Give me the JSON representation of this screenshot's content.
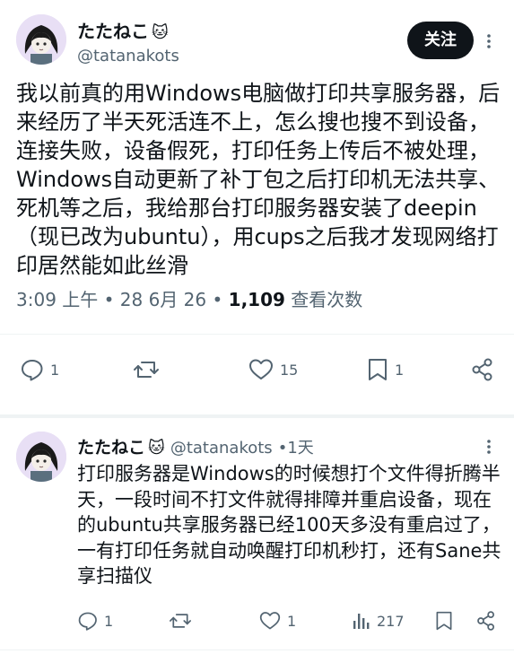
{
  "main_post": {
    "display_name": "たたねこ",
    "name_emoji": "🐱",
    "handle": "@tatanakots",
    "follow_label": "关注",
    "body": "我以前真的用Windows电脑做打印共享服务器，后来经历了半天死活连不上，怎么搜也搜不到设备，连接失败，设备假死，打印任务上传后不被处理，Windows自动更新了补丁包之后打印机无法共享、死机等之后，我给那台打印服务器安装了deepin（现已改为ubuntu），用cups之后我才发现网络打印居然能如此丝滑",
    "time": "3:09 上午",
    "date": "28 6月 26",
    "separator": "•",
    "views": "1,109",
    "views_label": "查看次数",
    "actions": {
      "reply_count": "1",
      "repost_count": "",
      "like_count": "15",
      "bookmark_count": "1"
    }
  },
  "reply_post": {
    "display_name": "たたねこ",
    "name_emoji": "🐱",
    "handle": "@tatanakots",
    "separator": "•",
    "time_ago": "1天",
    "body": "打印服务器是Windows的时候想打个文件得折腾半天，一段时间不打文件就得排障并重启设备，现在的ubuntu共享服务器已经100天多没有重启过了，一有打印任务就自动唤醒打印机秒打，还有Sane共享扫描仪",
    "actions": {
      "reply_count": "1",
      "repost_count": "",
      "like_count": "1",
      "views_count": "217"
    }
  },
  "icons": {
    "reply": "speech-bubble-icon",
    "repost": "repost-arrows-icon",
    "like": "heart-icon",
    "bookmark": "bookmark-icon",
    "share": "share-icon",
    "views": "bar-chart-icon",
    "more": "vertical-dots-icon"
  },
  "colors": {
    "text": "#0f1419",
    "secondary": "#536471",
    "follow_bg": "#0f1419",
    "follow_text": "#ffffff",
    "divider": "#eff3f4"
  }
}
